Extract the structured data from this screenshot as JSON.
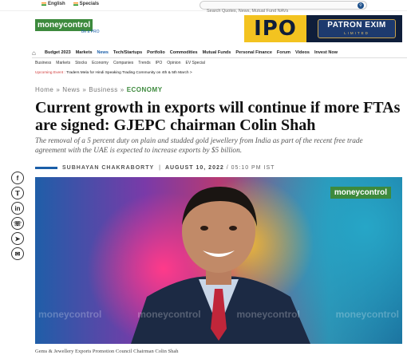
{
  "topbar": {
    "lang": "English",
    "special": "Specials",
    "search_placeholder": "Search Quotes, News, Mutual Fund NAVs"
  },
  "brand": {
    "logo": "moneycontrol",
    "sub": "Be a PRO"
  },
  "ad": {
    "ipo": "IPO",
    "company": "PATRON EXIM",
    "sub": "LIMITED"
  },
  "nav": {
    "items": [
      "Budget 2023",
      "Markets",
      "News",
      "Tech/Startups",
      "Portfolio",
      "Commodities",
      "Mutual Funds",
      "Personal Finance",
      "Forum",
      "Videos",
      "Invest Now"
    ],
    "sub_items": [
      "Business",
      "Markets",
      "Stocks",
      "Economy",
      "Companies",
      "Trends",
      "IPO",
      "Opinion",
      "EV Special"
    ]
  },
  "event": {
    "tag": "Upcoming Event :",
    "text": "Traders Mela for Hindi Speaking Trading Community on 4th & 5th March >"
  },
  "breadcrumb": {
    "home": "Home",
    "news": "News",
    "business": "Business",
    "current": "ECONOMY"
  },
  "article": {
    "headline": "Current growth in exports will continue if more FTAs are signed: GJEPC chairman Colin Shah",
    "summary": "The removal of a 5 percent duty on plain and studded gold jewellery from India as part of the recent free trade agreement with the UAE is expected to increase exports by $5 billion.",
    "author": "SUBHAYAN CHAKRABORTY",
    "date": "AUGUST 10, 2022",
    "time": "/ 05:10 PM IST",
    "caption": "Gems & Jewellery Exports Promotion Council Chairman Colin Shah",
    "watermark": "moneycontrol"
  },
  "share_icons": [
    "f",
    "t",
    "in",
    "w",
    "s",
    "m"
  ],
  "colors": {
    "brand_green": "#3d8a3d",
    "accent_blue": "#1a5ea8"
  }
}
